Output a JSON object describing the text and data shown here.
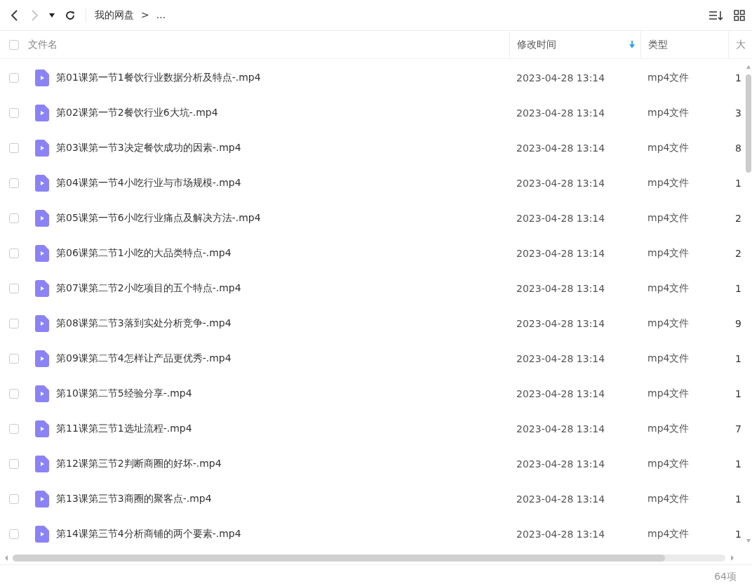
{
  "toolbar": {
    "back_disabled": false,
    "forward_disabled": true,
    "breadcrumb": [
      {
        "label": "我的网盘"
      },
      {
        "label": ">"
      },
      {
        "label": "..."
      }
    ]
  },
  "table": {
    "select_all_checked": false,
    "columns": [
      {
        "label": "文件名",
        "sorted": false
      },
      {
        "label": "修改时间",
        "sorted": true
      },
      {
        "label": "类型",
        "sorted": false
      },
      {
        "label": "大",
        "sorted": false
      }
    ],
    "rows": [
      {
        "checked": false,
        "name": "第01课第一节1餐饮行业数据分析及特点-.mp4",
        "modified": "2023-04-28 13:14",
        "type": "mp4文件",
        "size": "1"
      },
      {
        "checked": false,
        "name": "第02课第一节2餐饮行业6大坑-.mp4",
        "modified": "2023-04-28 13:14",
        "type": "mp4文件",
        "size": "3"
      },
      {
        "checked": false,
        "name": "第03课第一节3决定餐饮成功的因素-.mp4",
        "modified": "2023-04-28 13:14",
        "type": "mp4文件",
        "size": "8"
      },
      {
        "checked": false,
        "name": "第04课第一节4小吃行业与市场规模-.mp4",
        "modified": "2023-04-28 13:14",
        "type": "mp4文件",
        "size": "1"
      },
      {
        "checked": false,
        "name": "第05课第一节6小吃行业痛点及解决方法-.mp4",
        "modified": "2023-04-28 13:14",
        "type": "mp4文件",
        "size": "2"
      },
      {
        "checked": false,
        "name": "第06课第二节1小吃的大品类特点-.mp4",
        "modified": "2023-04-28 13:14",
        "type": "mp4文件",
        "size": "2"
      },
      {
        "checked": false,
        "name": "第07课第二节2小吃项目的五个特点-.mp4",
        "modified": "2023-04-28 13:14",
        "type": "mp4文件",
        "size": "1"
      },
      {
        "checked": false,
        "name": "第08课第二节3落到实处分析竞争-.mp4",
        "modified": "2023-04-28 13:14",
        "type": "mp4文件",
        "size": "9"
      },
      {
        "checked": false,
        "name": "第09课第二节4怎样让产品更优秀-.mp4",
        "modified": "2023-04-28 13:14",
        "type": "mp4文件",
        "size": "1"
      },
      {
        "checked": false,
        "name": "第10课第二节5经验分享-.mp4",
        "modified": "2023-04-28 13:14",
        "type": "mp4文件",
        "size": "1"
      },
      {
        "checked": false,
        "name": "第11课第三节1选址流程-.mp4",
        "modified": "2023-04-28 13:14",
        "type": "mp4文件",
        "size": "7"
      },
      {
        "checked": false,
        "name": "第12课第三节2判断商圈的好坏-.mp4",
        "modified": "2023-04-28 13:14",
        "type": "mp4文件",
        "size": "1"
      },
      {
        "checked": false,
        "name": "第13课第三节3商圈的聚客点-.mp4",
        "modified": "2023-04-28 13:14",
        "type": "mp4文件",
        "size": "1"
      },
      {
        "checked": false,
        "name": "第14课第三节4分析商铺的两个要素-.mp4",
        "modified": "2023-04-28 13:14",
        "type": "mp4文件",
        "size": "1"
      }
    ]
  },
  "status_bar": {
    "count": "64项"
  }
}
